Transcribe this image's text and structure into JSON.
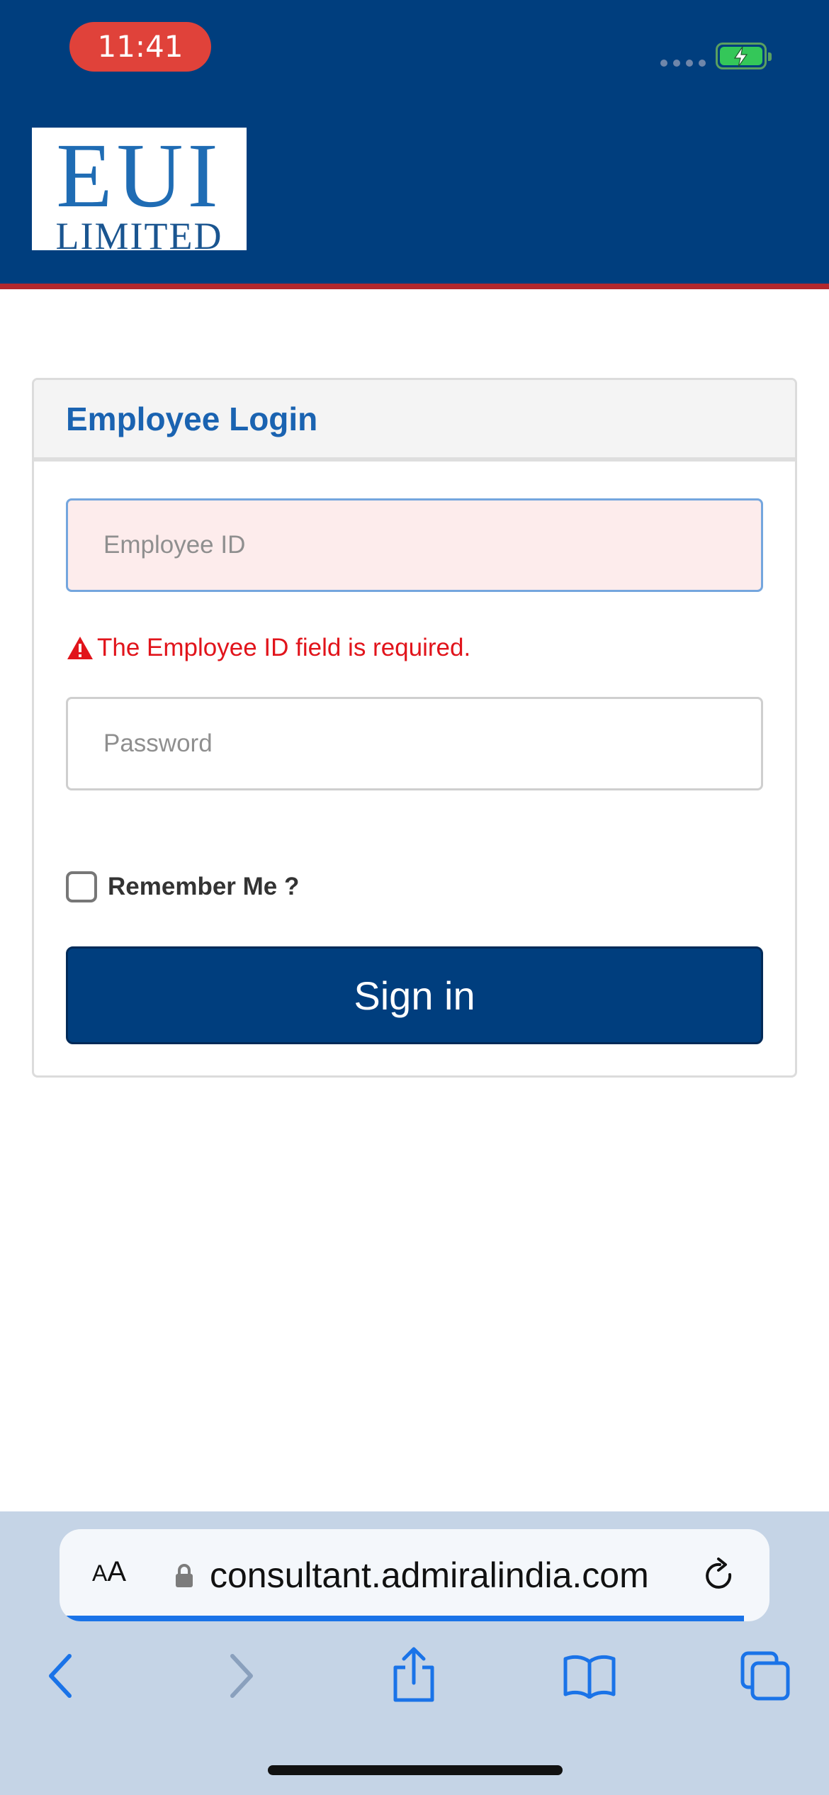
{
  "status_bar": {
    "time": "11:41"
  },
  "header": {
    "brand_color": "#003e7e",
    "accent_color": "#b3282d",
    "logo": {
      "top": "EUI",
      "bottom": "LIMITED"
    }
  },
  "login": {
    "title": "Employee Login",
    "employee_id": {
      "placeholder": "Employee ID",
      "value": "",
      "state": "error"
    },
    "error_message": "The Employee ID field is required.",
    "password": {
      "placeholder": "Password",
      "value": ""
    },
    "remember_me": {
      "label": "Remember Me ?",
      "checked": false
    },
    "submit_label": "Sign in"
  },
  "browser": {
    "text_size_button": {
      "small": "A",
      "large": "A"
    },
    "url": "consultant.admiralindia.com",
    "icons": [
      "lock-icon",
      "reload-icon",
      "back-icon",
      "forward-icon",
      "share-icon",
      "bookmarks-icon",
      "tabs-icon"
    ]
  }
}
